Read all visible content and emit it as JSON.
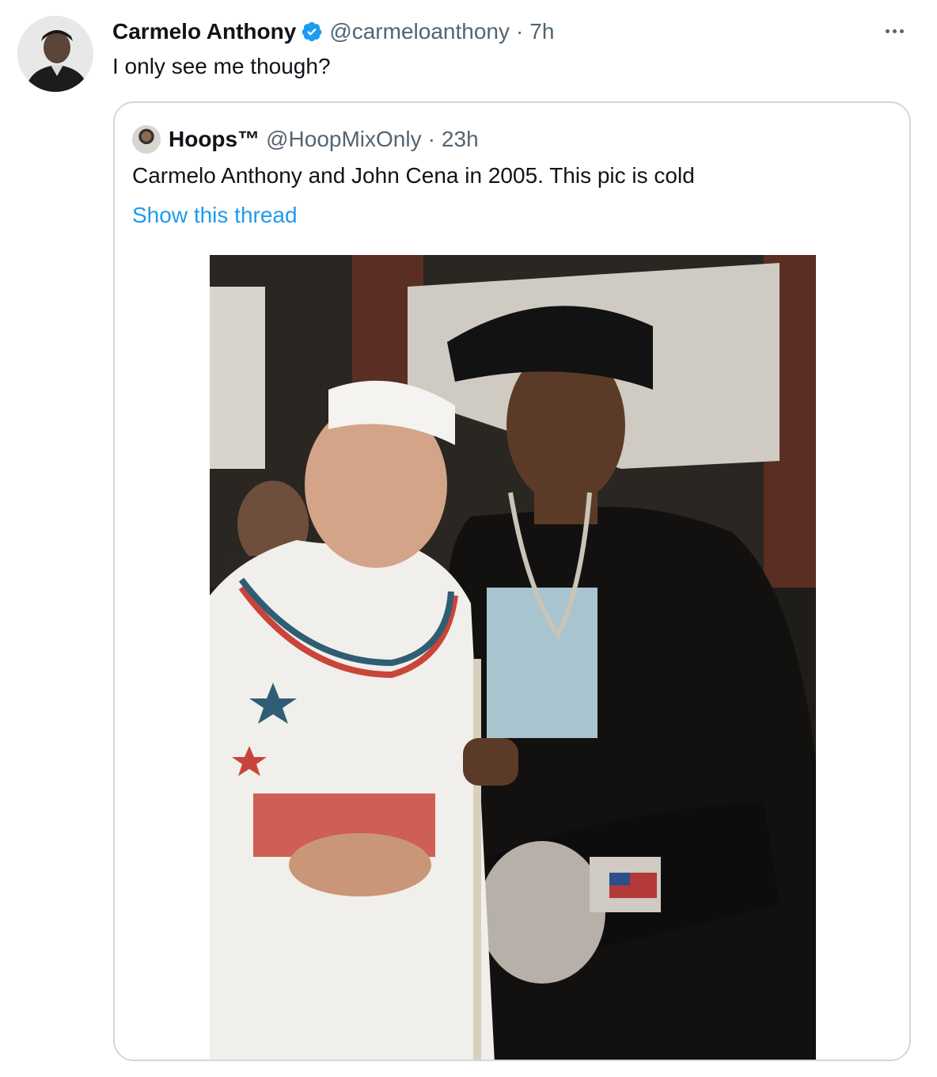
{
  "tweet": {
    "author_name": "Carmelo Anthony",
    "handle": "@carmeloanthony",
    "separator": "·",
    "time": "7h",
    "text": "I only see me though?",
    "verified_icon": "verified-badge-icon",
    "more_icon": "more-options-icon"
  },
  "quoted_tweet": {
    "author_name": "Hoops™",
    "handle": "@HoopMixOnly",
    "separator": "·",
    "time": "23h",
    "text": "Carmelo Anthony and John Cena in 2005. This pic is cold",
    "show_thread_label": "Show this thread"
  },
  "colors": {
    "primary_text": "#0f1419",
    "secondary_text": "#536471",
    "link": "#1d9bf0",
    "verified": "#1d9bf0",
    "border": "#cfd9de"
  }
}
